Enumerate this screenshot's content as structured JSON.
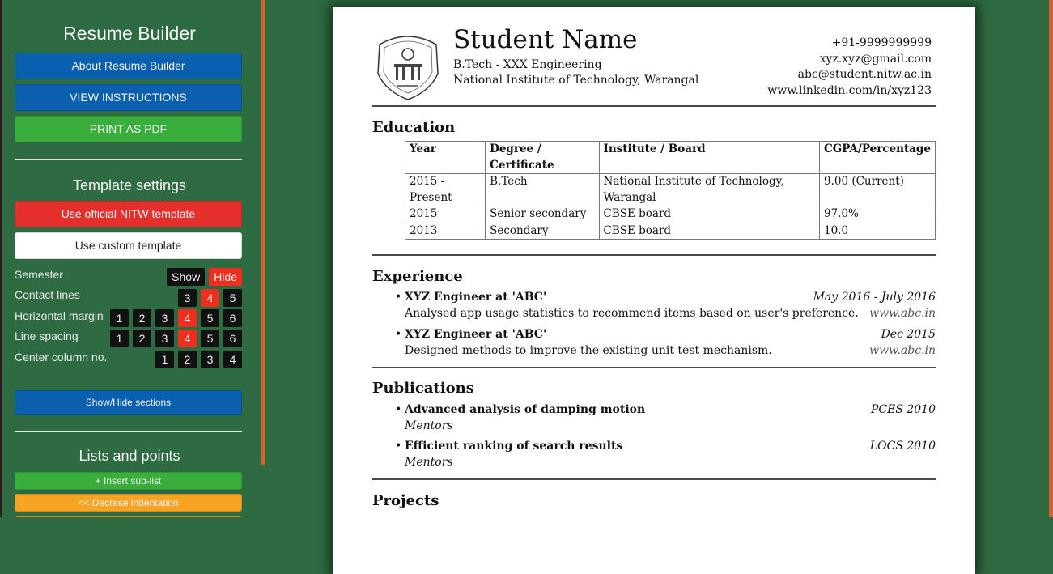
{
  "sidebar": {
    "title": "Resume Builder",
    "buttons": {
      "about": "About Resume Builder",
      "instructions": "VIEW INSTRUCTIONS",
      "print": "PRINT AS PDF"
    },
    "template_settings": {
      "title": "Template settings",
      "official": "Use official NITW template",
      "custom": "Use custom template",
      "options": [
        {
          "label": "Semester",
          "choices": [
            "Show",
            "Hide"
          ],
          "selected": "Hide"
        },
        {
          "label": "Contact lines",
          "choices": [
            "3",
            "4",
            "5"
          ],
          "selected": "4"
        },
        {
          "label": "Horizontal margin",
          "choices": [
            "1",
            "2",
            "3",
            "4",
            "5",
            "6"
          ],
          "selected": "4"
        },
        {
          "label": "Line spacing",
          "choices": [
            "1",
            "2",
            "3",
            "4",
            "5",
            "6"
          ],
          "selected": "4"
        },
        {
          "label": "Center column no.",
          "choices": [
            "1",
            "2",
            "3",
            "4"
          ],
          "selected": null
        }
      ],
      "sections_button": "Show/Hide sections"
    },
    "lists": {
      "title": "Lists and points",
      "insert_sublist": "+ Insert sub-list",
      "decrease_indent": "<< Decrese indentation"
    }
  },
  "colors": {
    "background": "#2e6b42",
    "blue": "#0a5fae",
    "green": "#3aae3c",
    "red": "#e52f2c",
    "orange": "#f8a423",
    "scrollbar": "#d2622a",
    "selected_option": "#ef2e1e"
  },
  "resume": {
    "name": "Student Name",
    "degree": "B.Tech - XXX Engineering",
    "institute": "National Institute of Technology, Warangal",
    "logo_icon": "nitw-emblem-icon",
    "contact": [
      "+91-9999999999",
      "xyz.xyz@gmail.com",
      "abc@student.nitw.ac.in",
      "www.linkedin.com/in/xyz123"
    ],
    "education": {
      "title": "Education",
      "headers": [
        "Year",
        "Degree / Certificate",
        "Institute / Board",
        "CGPA/Percentage"
      ],
      "rows": [
        [
          "2015 - Present",
          "B.Tech",
          "National Institute of Technology, Warangal",
          "9.00 (Current)"
        ],
        [
          "2015",
          "Senior secondary",
          "CBSE board",
          "97.0%"
        ],
        [
          "2013",
          "Secondary",
          "CBSE board",
          "10.0"
        ]
      ]
    },
    "experience": {
      "title": "Experience",
      "items": [
        {
          "title": "XYZ Engineer at 'ABC'",
          "date": "May 2016 - July 2016",
          "desc": "Analysed app usage statistics to recommend items based on user's preference.",
          "url": "www.abc.in"
        },
        {
          "title": "XYZ Engineer at 'ABC'",
          "date": "Dec 2015",
          "desc": "Designed methods to improve the existing unit test mechanism.",
          "url": "www.abc.in"
        }
      ]
    },
    "publications": {
      "title": "Publications",
      "items": [
        {
          "title": "Advanced analysis of damping motion",
          "venue": "PCES 2010",
          "mentor": "Mentors"
        },
        {
          "title": "Efficient ranking of search results",
          "venue": "LOCS 2010",
          "mentor": "Mentors"
        }
      ]
    },
    "projects": {
      "title": "Projects"
    }
  }
}
